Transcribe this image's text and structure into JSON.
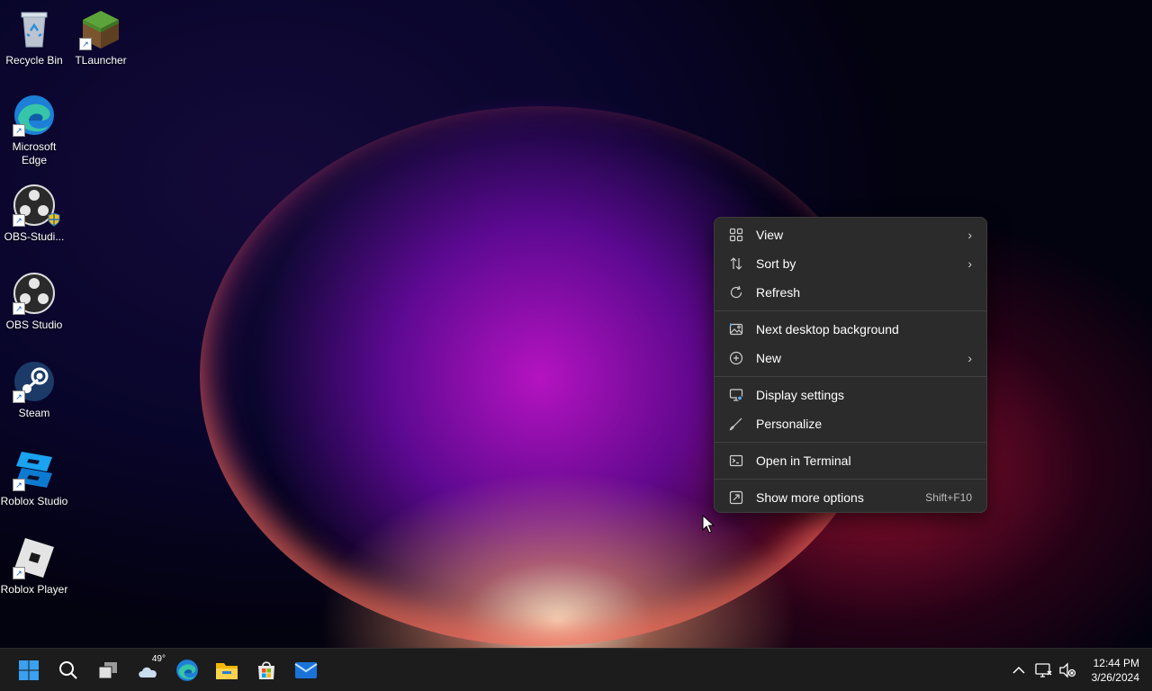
{
  "desktop": {
    "icons": [
      {
        "label": "Recycle Bin",
        "icon": "recycle-bin-icon"
      },
      {
        "label": "TLauncher",
        "icon": "minecraft-grass-block-icon"
      },
      {
        "label": "Microsoft Edge",
        "icon": "edge-icon"
      },
      {
        "label": "OBS-Studi...",
        "icon": "obs-icon"
      },
      {
        "label": "OBS Studio",
        "icon": "obs-icon"
      },
      {
        "label": "Steam",
        "icon": "steam-icon"
      },
      {
        "label": "Roblox Studio",
        "icon": "roblox-studio-icon"
      },
      {
        "label": "Roblox Player",
        "icon": "roblox-player-icon"
      }
    ]
  },
  "context_menu": {
    "items": [
      {
        "label": "View",
        "icon": "grid-icon",
        "submenu": true
      },
      {
        "label": "Sort by",
        "icon": "sort-icon",
        "submenu": true
      },
      {
        "label": "Refresh",
        "icon": "refresh-icon",
        "submenu": false
      },
      {
        "label": "Next desktop background",
        "icon": "image-icon",
        "submenu": false
      },
      {
        "label": "New",
        "icon": "plus-circle-icon",
        "submenu": true
      },
      {
        "label": "Display settings",
        "icon": "monitor-icon",
        "submenu": false
      },
      {
        "label": "Personalize",
        "icon": "brush-icon",
        "submenu": false
      },
      {
        "label": "Open in Terminal",
        "icon": "terminal-icon",
        "submenu": false
      },
      {
        "label": "Show more options",
        "icon": "more-options-icon",
        "submenu": false,
        "shortcut": "Shift+F10"
      }
    ]
  },
  "taskbar": {
    "weather_temp": "49°",
    "time": "12:44 PM",
    "date": "3/26/2024"
  },
  "colors": {
    "menu_bg": "#2b2b2b",
    "taskbar_bg": "#1c1c1c",
    "windows_blue": "#3aa0f0"
  }
}
